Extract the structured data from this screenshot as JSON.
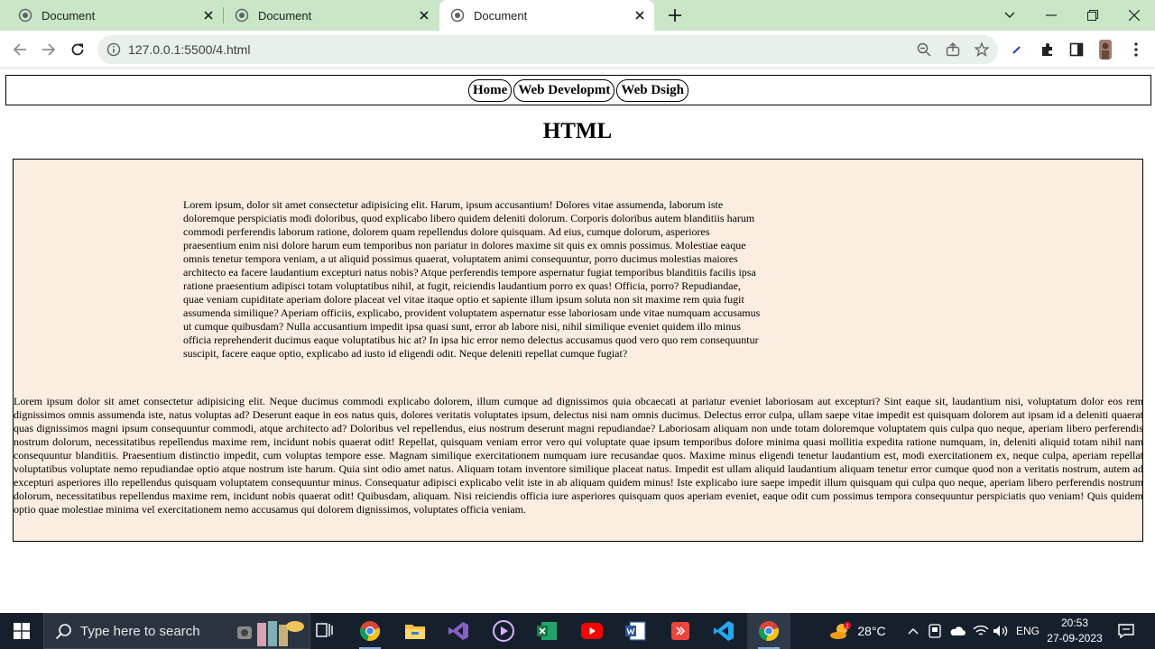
{
  "browser": {
    "tabs": [
      {
        "title": "Document"
      },
      {
        "title": "Document"
      },
      {
        "title": "Document"
      }
    ],
    "url": "127.0.0.1:5500/4.html"
  },
  "page": {
    "nav": [
      "Home",
      "Web Developmt",
      "Web Dsigh"
    ],
    "heading": "HTML",
    "paragraph1": "Lorem ipsum, dolor sit amet consectetur adipisicing elit. Harum, ipsum accusantium! Dolores vitae assumenda, laborum iste doloremque perspiciatis modi doloribus, quod explicabo libero quidem deleniti dolorum. Corporis doloribus autem blanditiis harum commodi perferendis laborum ratione, dolorem quam repellendus dolore quisquam. Ad eius, cumque dolorum, asperiores praesentium enim nisi dolore harum eum temporibus non pariatur in dolores maxime sit quis ex omnis possimus. Molestiae eaque omnis tenetur tempora veniam, a ut aliquid possimus quaerat, voluptatem animi consequuntur, porro ducimus molestias maiores architecto ea facere laudantium excepturi natus nobis? Atque perferendis tempore aspernatur fugiat temporibus blanditiis facilis ipsa ratione praesentium adipisci totam voluptatibus nihil, at fugit, reiciendis laudantium porro ex quas! Officia, porro? Repudiandae, quae veniam cupiditate aperiam dolore placeat vel vitae itaque optio et sapiente illum ipsum soluta non sit maxime rem quia fugit assumenda similique? Aperiam officiis, explicabo, provident voluptatem aspernatur esse laboriosam unde vitae numquam accusamus ut cumque quibusdam? Nulla accusantium impedit ipsa quasi sunt, error ab labore nisi, nihil similique eveniet quidem illo minus officia reprehenderit ducimus eaque voluptatibus hic at? In ipsa hic error nemo delectus accusamus quod vero quo rem consequuntur suscipit, facere eaque optio, explicabo ad iusto id eligendi odit. Neque deleniti repellat cumque fugiat?",
    "paragraph2": "Lorem ipsum dolor sit amet consectetur adipisicing elit. Neque ducimus commodi explicabo dolorem, illum cumque ad dignissimos quia obcaecati at pariatur eveniet laboriosam aut excepturi? Sint eaque sit, laudantium nisi, voluptatum dolor eos rem dignissimos omnis assumenda iste, natus voluptas ad? Deserunt eaque in eos natus quis, dolores veritatis voluptates ipsum, delectus nisi nam omnis ducimus. Delectus error culpa, ullam saepe vitae impedit est quisquam dolorem aut ipsam id a deleniti quaerat quas dignissimos magni ipsum consequuntur commodi, atque architecto ad? Doloribus vel repellendus, eius nostrum deserunt magni repudiandae? Laboriosam aliquam non unde totam doloremque voluptatem quis culpa quo neque, aperiam libero perferendis nostrum dolorum, necessitatibus repellendus maxime rem, incidunt nobis quaerat odit! Repellat, quisquam veniam error vero qui voluptate quae ipsum temporibus dolore minima quasi mollitia expedita ratione numquam, in, deleniti aliquid totam nihil nam consequuntur blanditiis. Praesentium distinctio impedit, cum voluptas tempore esse. Magnam similique exercitationem numquam iure recusandae quos. Maxime minus eligendi tenetur laudantium est, modi exercitationem ex, neque culpa, aperiam repellat voluptatibus voluptate nemo repudiandae optio atque nostrum iste harum. Quia sint odio amet natus. Aliquam totam inventore similique placeat natus. Impedit est ullam aliquid laudantium aliquam tenetur error cumque quod non a veritatis nostrum, autem ad excepturi asperiores illo repellendus quisquam voluptatem consequuntur minus. Consequatur adipisci explicabo velit iste in ab aliquam quidem minus! Iste explicabo iure saepe impedit illum quisquam qui culpa quo neque, aperiam libero perferendis nostrum dolorum, necessitatibus repellendus maxime rem, incidunt nobis quaerat odit! Quibusdam, aliquam. Nisi reiciendis officia iure asperiores quisquam quos aperiam eveniet, eaque odit cum possimus tempora consequuntur perspiciatis quo veniam! Quis quidem optio quae molestiae minima vel exercitationem nemo accusamus qui dolorem dignissimos, voluptates officia veniam."
  },
  "taskbar": {
    "search_placeholder": "Type here to search",
    "weather": "28°C",
    "weather_badge": "1",
    "lang": "ENG",
    "time": "20:53",
    "date": "27-09-2023"
  },
  "colors": {
    "tabstrip": "#c9e7c7",
    "content_box": "#fbeddf",
    "taskbar": "#16202d"
  }
}
